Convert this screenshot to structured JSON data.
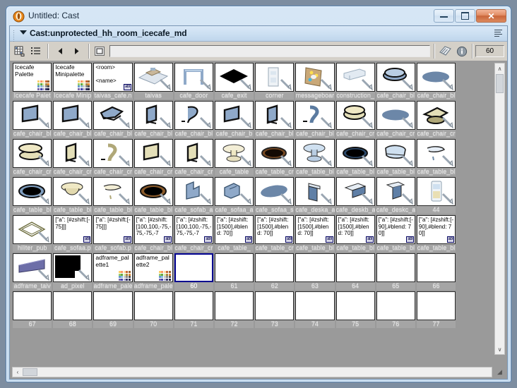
{
  "window": {
    "title": "Untitled: Cast",
    "icon": "director-app-icon",
    "buttons": {
      "minimize": "minimize",
      "maximize": "maximize",
      "close": "✕"
    }
  },
  "castbar": {
    "title": "Cast:unprotected_hh_room_icecafe_md",
    "expand_icon": "chevron-down-icon",
    "menu_icon": "panel-menu-icon"
  },
  "toolbar": {
    "thumbnail_view_icon": "thumbnail-view-icon",
    "list_view_icon": "list-view-icon",
    "prev_icon": "previous-cast-member-icon",
    "next_icon": "next-cast-member-icon",
    "member_type_icon": "cast-member-type-icon",
    "name_value": "",
    "name_placeholder": "",
    "tag_icon": "cast-member-properties-icon",
    "info_icon": "cast-member-info-icon",
    "member_number": "60"
  },
  "scroll": {
    "up_icon": "∧",
    "down_icon": "∨",
    "left_icon": "‹",
    "right_icon": "›",
    "resize_icon": "◢"
  },
  "grid": {
    "selected_number": "60",
    "rows": [
      [
        {
          "label": "Icecafe Palet",
          "kind": "text-palette",
          "text": "Icecafe\nPalette"
        },
        {
          "label": "Icecafe Minip",
          "kind": "text-palette",
          "text": "Icecafe\nMinipalette"
        },
        {
          "label": "taivas_cafe.n",
          "kind": "text-field",
          "text": "<room>\n\n<name>",
          "obl": "abl"
        },
        {
          "label": "taivas",
          "kind": "art-floor"
        },
        {
          "label": "cafe_door",
          "kind": "art-door"
        },
        {
          "label": "cafe_exit",
          "kind": "art-diamond"
        },
        {
          "label": "corner",
          "kind": "art-corner"
        },
        {
          "label": "messageboar",
          "kind": "art-board"
        },
        {
          "label": "construction_",
          "kind": "art-beam"
        },
        {
          "label": "cafe_chair_bl",
          "kind": "art-chairb-top"
        },
        {
          "label": "cafe_chair_bl",
          "kind": "art-blob-blue"
        }
      ],
      [
        {
          "label": "cafe_chair_bl",
          "kind": "art-chairb-1"
        },
        {
          "label": "cafe_chair_bl",
          "kind": "art-chairb-2"
        },
        {
          "label": "cafe_chair_bl",
          "kind": "art-chairb-3"
        },
        {
          "label": "cafe_chair_bl",
          "kind": "art-chairb-4"
        },
        {
          "label": "cafe_chair_bl",
          "kind": "art-chairb-5"
        },
        {
          "label": "cafe_chair_b",
          "kind": "art-chairb-6"
        },
        {
          "label": "cafe_chair_bl",
          "kind": "art-chairb-7"
        },
        {
          "label": "cafe_chair_bl",
          "kind": "art-chairb-8"
        },
        {
          "label": "cafe_chair_cr",
          "kind": "art-chairc-top"
        },
        {
          "label": "cafe_chair_cr",
          "kind": "art-blob-blue"
        },
        {
          "label": "cafe_chair_cr",
          "kind": "art-chairc-4"
        }
      ],
      [
        {
          "label": "cafe_chair_cr",
          "kind": "art-chairc-1"
        },
        {
          "label": "cafe_chair_cr",
          "kind": "art-chairc-2"
        },
        {
          "label": "cafe_chair_cr",
          "kind": "art-chairc-3"
        },
        {
          "label": "cafe_chair_cr",
          "kind": "art-chairc-5"
        },
        {
          "label": "cafe_chair_cr",
          "kind": "art-chairc-6"
        },
        {
          "label": "cafe_table",
          "kind": "art-table-cream"
        },
        {
          "label": "cafe_table_cr",
          "kind": "art-table-brown"
        },
        {
          "label": "cafe_table_bl",
          "kind": "art-table-blue"
        },
        {
          "label": "cafe_table_bl",
          "kind": "art-table-ovalblk"
        },
        {
          "label": "cafe_table_bl",
          "kind": "art-table-bl2"
        },
        {
          "label": "cafe_table_bl",
          "kind": "art-table-bl3"
        }
      ],
      [
        {
          "label": "cafe_table_bl",
          "kind": "art-table-oval1"
        },
        {
          "label": "cafe_table_bl",
          "kind": "art-table-oval2"
        },
        {
          "label": "cafe_table_bl",
          "kind": "art-table-oval3"
        },
        {
          "label": "cafe_table_bl",
          "kind": "art-table-oval4"
        },
        {
          "label": "cafe_sofab_a",
          "kind": "art-sofa-1"
        },
        {
          "label": "cafe_sofaa_a",
          "kind": "art-sofa-2"
        },
        {
          "label": "cafe_sofaa_s",
          "kind": "art-sofa-blob"
        },
        {
          "label": "cafe_deska_a",
          "kind": "art-desk-1"
        },
        {
          "label": "cafe_deskb_a",
          "kind": "art-desk-2"
        },
        {
          "label": "cafe_deskc_a",
          "kind": "art-desk-3"
        },
        {
          "label": "44",
          "kind": "art-poster"
        }
      ],
      [
        {
          "label": "hiliter_pub",
          "kind": "art-hilite"
        },
        {
          "label": "cafe_sofaa.p",
          "kind": "script",
          "text": "[\"a\": [#zshift:[-75]]]",
          "obl": "abl"
        },
        {
          "label": "cafe_sofab.p",
          "kind": "script",
          "text": "[\"a\": [#zshift:[-75]]]",
          "obl": "abl"
        },
        {
          "label": "cafe_chair_bl",
          "kind": "script",
          "text": "[\"a\": [#zshift:[100,100,-75,-75,-75,-7",
          "obl": "abl"
        },
        {
          "label": "cafe_chair_cr",
          "kind": "script",
          "text": "[\"a\": [#zshift:[100,100,-75,-75,-75,-7",
          "obl": "abl"
        },
        {
          "label": "cafe_table_",
          "kind": "script",
          "text": "[\"a\": [#zshift:[1500],#blend: 70]]",
          "obl": "abl"
        },
        {
          "label": "cafe_table_cr",
          "kind": "script",
          "text": "[\"a\": [#zshift:[1500],#blend: 70]]",
          "obl": "abl"
        },
        {
          "label": "cafe_table_bl",
          "kind": "script",
          "text": "[\"a\": [#zshift:[1500],#blend: 70]]",
          "obl": "abl"
        },
        {
          "label": "cafe_table_bl",
          "kind": "script",
          "text": "[\"a\": [#zshift:[1500],#blend: 70]]",
          "obl": "abl"
        },
        {
          "label": "cafe_table_bl",
          "kind": "script",
          "text": "[\"a\": [#zshift:[-90],#blend: 70]]",
          "obl": "abl"
        },
        {
          "label": "cafe_table_bl",
          "kind": "script",
          "text": "[\"a\": [#zshift:[-90],#blend: 70]]",
          "obl": "abl"
        }
      ],
      [
        {
          "label": "adframe_taiv",
          "kind": "art-adframe"
        },
        {
          "label": "ad_pixel",
          "kind": "art-adpixel"
        },
        {
          "label": "adframe_pale",
          "kind": "text-palette",
          "text": "adframe_palette1"
        },
        {
          "label": "adframe_pale",
          "kind": "text-palette",
          "text": "adframe_palette2"
        },
        {
          "label": "60",
          "kind": "empty",
          "selected": true
        },
        {
          "label": "61",
          "kind": "empty"
        },
        {
          "label": "62",
          "kind": "empty"
        },
        {
          "label": "63",
          "kind": "empty"
        },
        {
          "label": "64",
          "kind": "empty"
        },
        {
          "label": "65",
          "kind": "empty"
        },
        {
          "label": "66",
          "kind": "empty"
        }
      ],
      [
        {
          "label": "67",
          "kind": "empty"
        },
        {
          "label": "68",
          "kind": "empty"
        },
        {
          "label": "69",
          "kind": "empty"
        },
        {
          "label": "70",
          "kind": "empty"
        },
        {
          "label": "71",
          "kind": "empty"
        },
        {
          "label": "72",
          "kind": "empty"
        },
        {
          "label": "73",
          "kind": "empty"
        },
        {
          "label": "74",
          "kind": "empty"
        },
        {
          "label": "75",
          "kind": "empty"
        },
        {
          "label": "76",
          "kind": "empty"
        },
        {
          "label": "77",
          "kind": "empty"
        }
      ]
    ]
  },
  "colors": {
    "accent_selection": "#00008f",
    "label_bg": "#a5a5a5",
    "grid_bg": "#9a9a9a",
    "toolbar_bg": "#d4d0c8",
    "chrome_blue": "#cfe1f2"
  }
}
